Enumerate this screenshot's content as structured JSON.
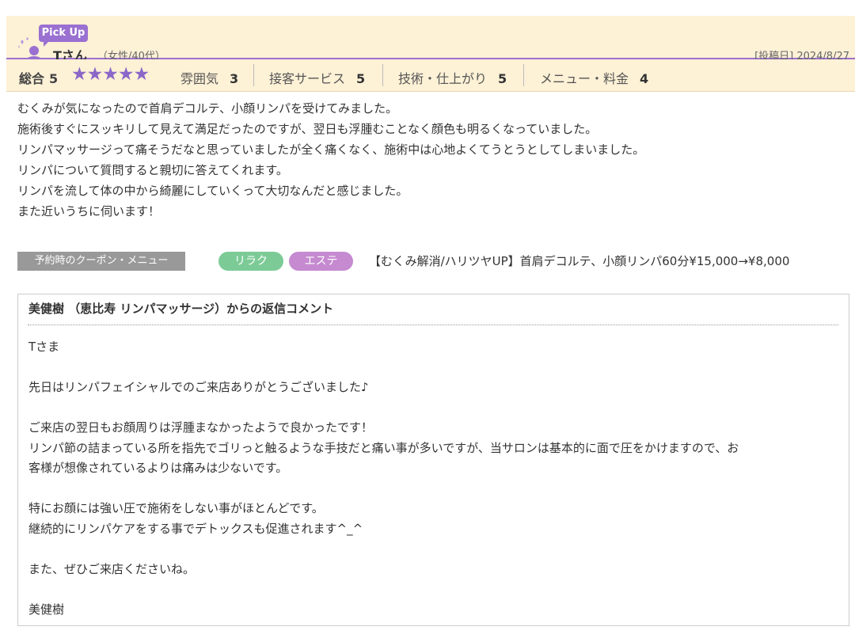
{
  "header": {
    "pickup_label": "Pick Up",
    "reviewer_name": "Tさん",
    "reviewer_attr": "（女性/40代）",
    "posted_date": "[投稿日] 2024/8/27",
    "icon": "user-avatar-icon"
  },
  "ratings": {
    "total_label": "総合",
    "total_value": "5",
    "stars": "★★★★★",
    "items": [
      {
        "label": "雰囲気",
        "value": "3"
      },
      {
        "label": "接客サービス",
        "value": "5"
      },
      {
        "label": "技術・仕上がり",
        "value": "5"
      },
      {
        "label": "メニュー・料金",
        "value": "4"
      }
    ],
    "star_color": "#8b67c8"
  },
  "review": {
    "lines": [
      "むくみが気になったので首肩デコルテ、小顔リンパを受けてみました。",
      "施術後すぐにスッキリして見えて満足だったのですが、翌日も浮腫むことなく顔色も明るくなっていました。",
      "リンパマッサージって痛そうだなと思っていましたが全く痛くなく、施術中は心地よくてうとうとしてしまいました。",
      "リンパについて質問すると親切に答えてくれます。",
      "リンパを流して体の中から綺麗にしていくって大切なんだと感じました。",
      "また近いうちに伺います！"
    ]
  },
  "coupon": {
    "label": "予約時のクーポン・メニュー",
    "tags": [
      "リラク",
      "エステ"
    ],
    "text": "【むくみ解消/ハリツヤUP】首肩デコルテ、小顔リンパ60分¥15,000→¥8,000"
  },
  "reply": {
    "title": "美健樹 （恵比寿 リンパマッサージ）からの返信コメント",
    "lines": [
      "Tさま",
      "",
      "先日はリンパフェイシャルでのご来店ありがとうございました♪",
      "",
      "ご来店の翌日もお顔周りは浮腫まなかったようで良かったです！",
      "リンパ節の詰まっている所を指先でゴリっと触るような手技だと痛い事が多いですが、当サロンは基本的に面で圧をかけますので、お",
      "客様が想像されているよりは痛みは少ないです。",
      "",
      "特にお顔には強い圧で施術をしない事がほとんどです。",
      "継続的にリンパケアをする事でデトックスも促進されます^_^",
      "",
      "また、ぜひご来店くださいね。",
      "",
      "美健樹"
    ]
  }
}
